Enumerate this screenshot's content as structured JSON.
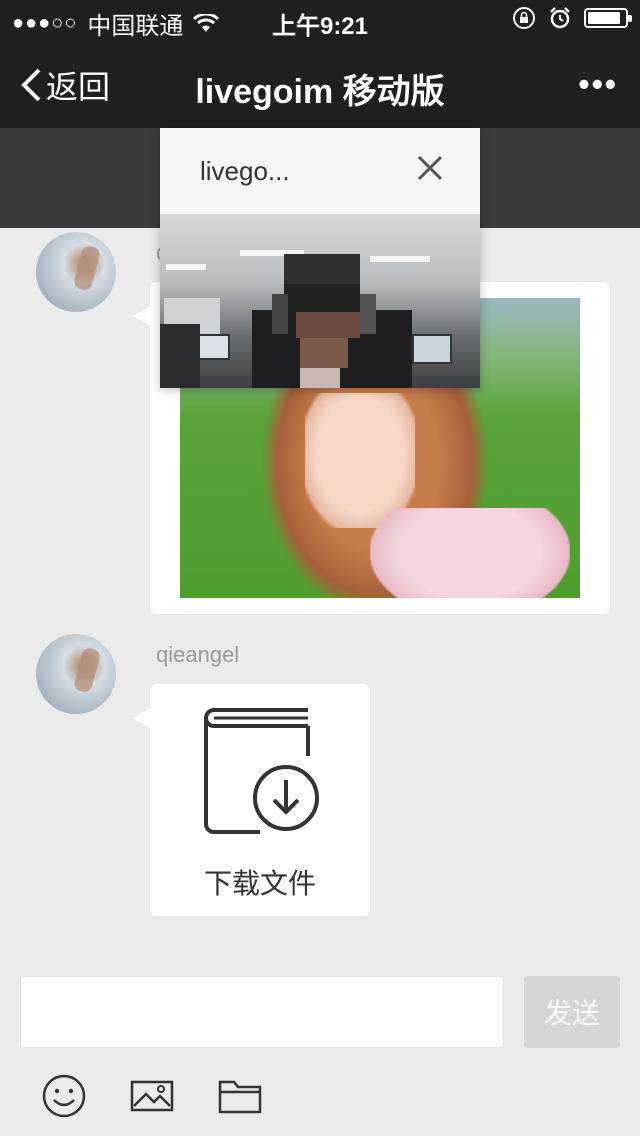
{
  "status_bar": {
    "signal": "●●●○○",
    "carrier": "中国联通",
    "time": "上午9:21",
    "battery_level": 0.9
  },
  "nav": {
    "back_label": "返回",
    "title": "livegoim 移动版",
    "more_label": "•••"
  },
  "popup": {
    "title": "livego..."
  },
  "messages": [
    {
      "type": "image",
      "username": "q"
    },
    {
      "type": "file",
      "username": "qieangel",
      "file_label": "下载文件"
    }
  ],
  "composer": {
    "input_value": "",
    "send_label": "发送"
  },
  "toolbar": {
    "icons": [
      "emoji-icon",
      "image-icon",
      "folder-icon"
    ]
  },
  "colors": {
    "nav_bg": "#1f1f21",
    "chat_bg": "#ebebeb",
    "send_disabled": "#d6d6d6"
  }
}
